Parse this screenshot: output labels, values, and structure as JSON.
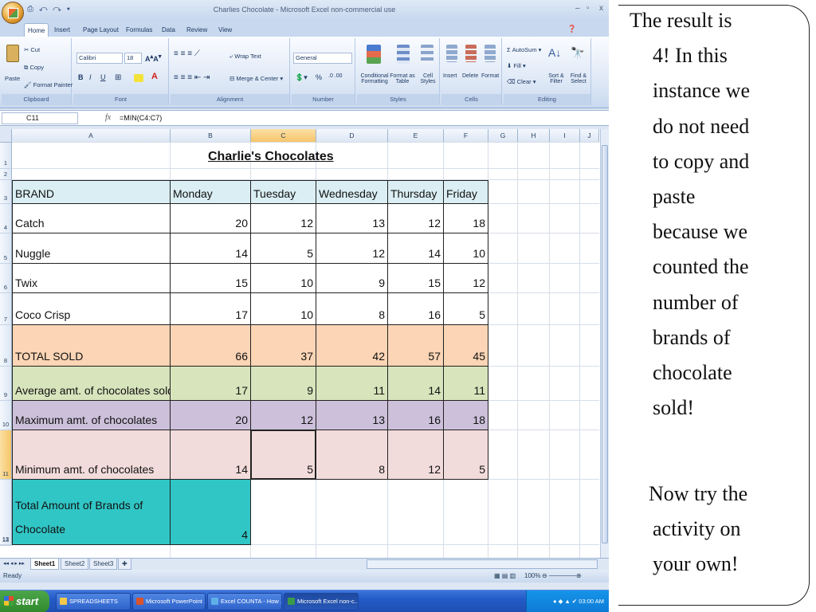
{
  "window": {
    "title": "Charlies Chocolate - Microsoft Excel non-commercial use",
    "quick_access": "⎙ ↶ ↷ ▾",
    "controls": [
      "–",
      "▫",
      "x"
    ]
  },
  "ribbon": {
    "tabs": [
      "Home",
      "Insert",
      "Page Layout",
      "Formulas",
      "Data",
      "Review",
      "View"
    ],
    "active_tab": "Home",
    "clipboard": {
      "paste": "Paste",
      "cut": "Cut",
      "copy": "Copy",
      "format_painter": "Format Painter",
      "label": "Clipboard"
    },
    "font": {
      "name": "Calibri",
      "size": "18",
      "bold": "B",
      "italic": "I",
      "underline": "U",
      "label": "Font"
    },
    "alignment": {
      "wrap": "Wrap Text",
      "merge": "Merge & Center",
      "label": "Alignment"
    },
    "number": {
      "format": "General",
      "percent": "%",
      "label": "Number"
    },
    "styles": {
      "conditional": "Conditional Formatting",
      "format_table": "Format as Table",
      "cell_styles": "Cell Styles",
      "label": "Styles"
    },
    "cells": {
      "insert": "Insert",
      "delete": "Delete",
      "format": "Format",
      "label": "Cells"
    },
    "editing": {
      "autosum": "AutoSum",
      "fill": "Fill",
      "clear": "Clear",
      "sort": "Sort & Filter",
      "find": "Find & Select",
      "label": "Editing"
    }
  },
  "formula_bar": {
    "name_box": "C11",
    "fx": "fx",
    "formula": "=MIN(C4:C7)"
  },
  "sheet": {
    "columns": [
      "A",
      "B",
      "C",
      "D",
      "E",
      "F",
      "G",
      "H",
      "I",
      "J"
    ],
    "selected_column": "C",
    "row_numbers": [
      "1",
      "2",
      "3",
      "4",
      "5",
      "6",
      "7",
      "8",
      "9",
      "10",
      "11",
      "12",
      "13"
    ],
    "selected_row": "11",
    "title": "Charlie's Chocolates",
    "headers": [
      "BRAND",
      "Monday",
      "Tuesday",
      "Wednesday",
      "Thursday",
      "Friday"
    ],
    "rows": [
      {
        "label": "Catch",
        "values": [
          "20",
          "12",
          "13",
          "12",
          "18"
        ]
      },
      {
        "label": "Nuggle",
        "values": [
          "14",
          "5",
          "12",
          "14",
          "10"
        ]
      },
      {
        "label": "Twix",
        "values": [
          "15",
          "10",
          "9",
          "15",
          "12"
        ]
      },
      {
        "label": "Coco Crisp",
        "values": [
          "17",
          "10",
          "8",
          "16",
          "5"
        ]
      },
      {
        "label": "TOTAL SOLD",
        "values": [
          "66",
          "37",
          "42",
          "57",
          "45"
        ]
      },
      {
        "label": "Average amt. of chocolates sold",
        "values": [
          "17",
          "9",
          "11",
          "14",
          "11"
        ]
      },
      {
        "label": "Maximum amt. of chocolates",
        "values": [
          "20",
          "12",
          "13",
          "16",
          "18"
        ]
      },
      {
        "label": "Minimum amt. of chocolates",
        "values": [
          "14",
          "5",
          "8",
          "12",
          "5"
        ]
      }
    ],
    "brands_label_line1": "Total Amount of Brands of",
    "brands_label_line2": "Chocolate",
    "brands_value": "4",
    "colors": {
      "header_bg": "#daeef3",
      "total_bg": "#fbd5b5",
      "average_bg": "#d8e4bc",
      "maximum_bg": "#ccc0da",
      "minimum_bg": "#f2dcdb",
      "brands_bg": "#31c6c6"
    }
  },
  "sheet_tabs": [
    "Sheet1",
    "Sheet2",
    "Sheet3"
  ],
  "status": {
    "ready": "Ready",
    "zoom": "100%"
  },
  "taskbar": {
    "start": "start",
    "buttons": [
      "SPREADSHEETS",
      "Microsoft PowerPoint ...",
      "Excel COUNTA - How ...",
      "Microsoft Excel non-c..."
    ],
    "clock": "03:00 AM"
  },
  "slide_text": {
    "lines": [
      "The result is",
      "4! In this",
      "instance we",
      "do not need",
      "to copy and",
      "paste",
      "because we",
      "counted the",
      "number of",
      "brands of",
      "chocolate",
      "sold!"
    ],
    "lines2": [
      "Now try the",
      "activity on",
      "your own!"
    ]
  }
}
